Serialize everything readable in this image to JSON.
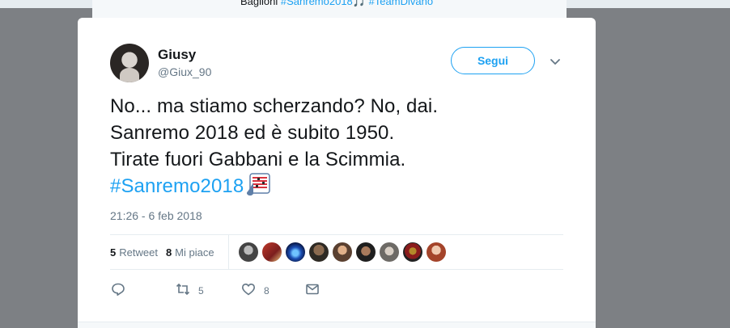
{
  "background_tweet": {
    "text_prefix": "Baglioni ",
    "hashtags": "#Sanremo2018🎵 #TeamDivano"
  },
  "tweet": {
    "author_name": "Giusy",
    "author_handle": "@Giux_90",
    "follow_label": "Segui",
    "text_lines": [
      "No... ma stiamo scherzando? No, dai.",
      "Sanremo 2018 ed è subito 1950.",
      "Tirate fuori Gabbani e la Scimmia."
    ],
    "hashtag": "#Sanremo2018",
    "timestamp": "21:26 - 6 feb 2018",
    "retweet_count": "5",
    "retweet_label": "Retweet",
    "like_count": "8",
    "like_label": "Mi piace",
    "action_retweet_count": "5",
    "action_like_count": "8"
  },
  "icons": {
    "reply": "reply-icon",
    "retweet": "retweet-icon",
    "like": "heart-icon",
    "dm": "envelope-icon",
    "caret": "chevron-down-icon",
    "emoji": "musical-score-emoji"
  },
  "colors": {
    "accent": "#1da1f2",
    "text": "#14171a",
    "muted": "#657786",
    "backdrop": "#7d8084"
  }
}
